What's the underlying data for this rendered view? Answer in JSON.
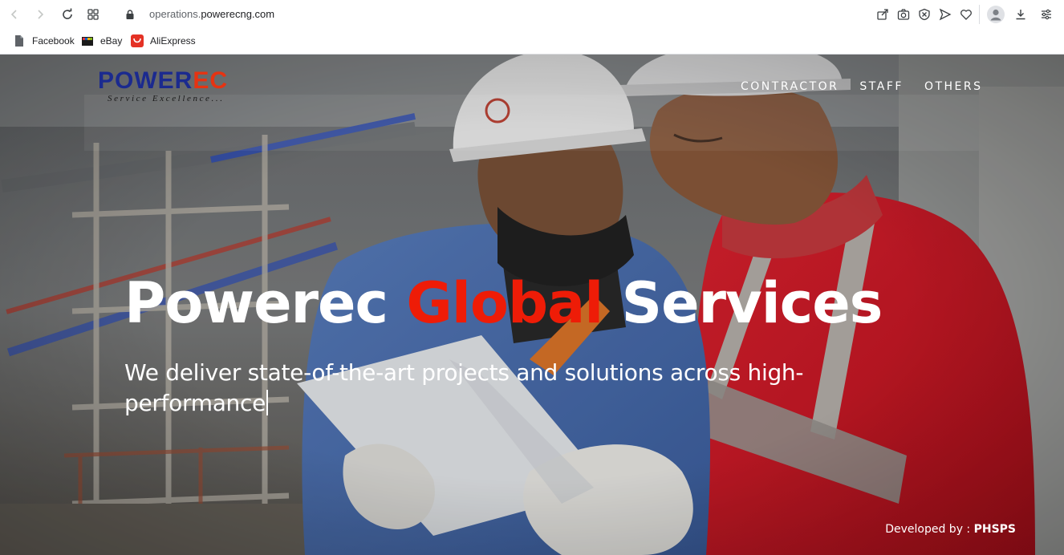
{
  "browser": {
    "url_prefix": "operations.",
    "url_host": "powerecng.com",
    "bookmarks": [
      {
        "label": "Facebook",
        "icon": "file-icon"
      },
      {
        "label": "eBay",
        "icon": "ebay-icon"
      },
      {
        "label": "AliExpress",
        "icon": "aliexpress-icon"
      }
    ]
  },
  "site": {
    "logo_prefix": "POWER",
    "logo_suffix": "EC",
    "logo_tagline": "Service Excellence...",
    "nav": [
      "CONTRACTOR",
      "STAFF",
      "OTHERS"
    ],
    "hero_title_part1": "Powerec ",
    "hero_title_accent": "Global",
    "hero_title_part2": " Services",
    "hero_subtitle": "We deliver state-of-the-art projects and solutions across high-performance",
    "credit_label": "Developed by : ",
    "credit_name": "PHSPS"
  },
  "colors": {
    "brand_blue": "#1b2a8f",
    "brand_red": "#e63312",
    "accent_red": "#ee1c07"
  }
}
